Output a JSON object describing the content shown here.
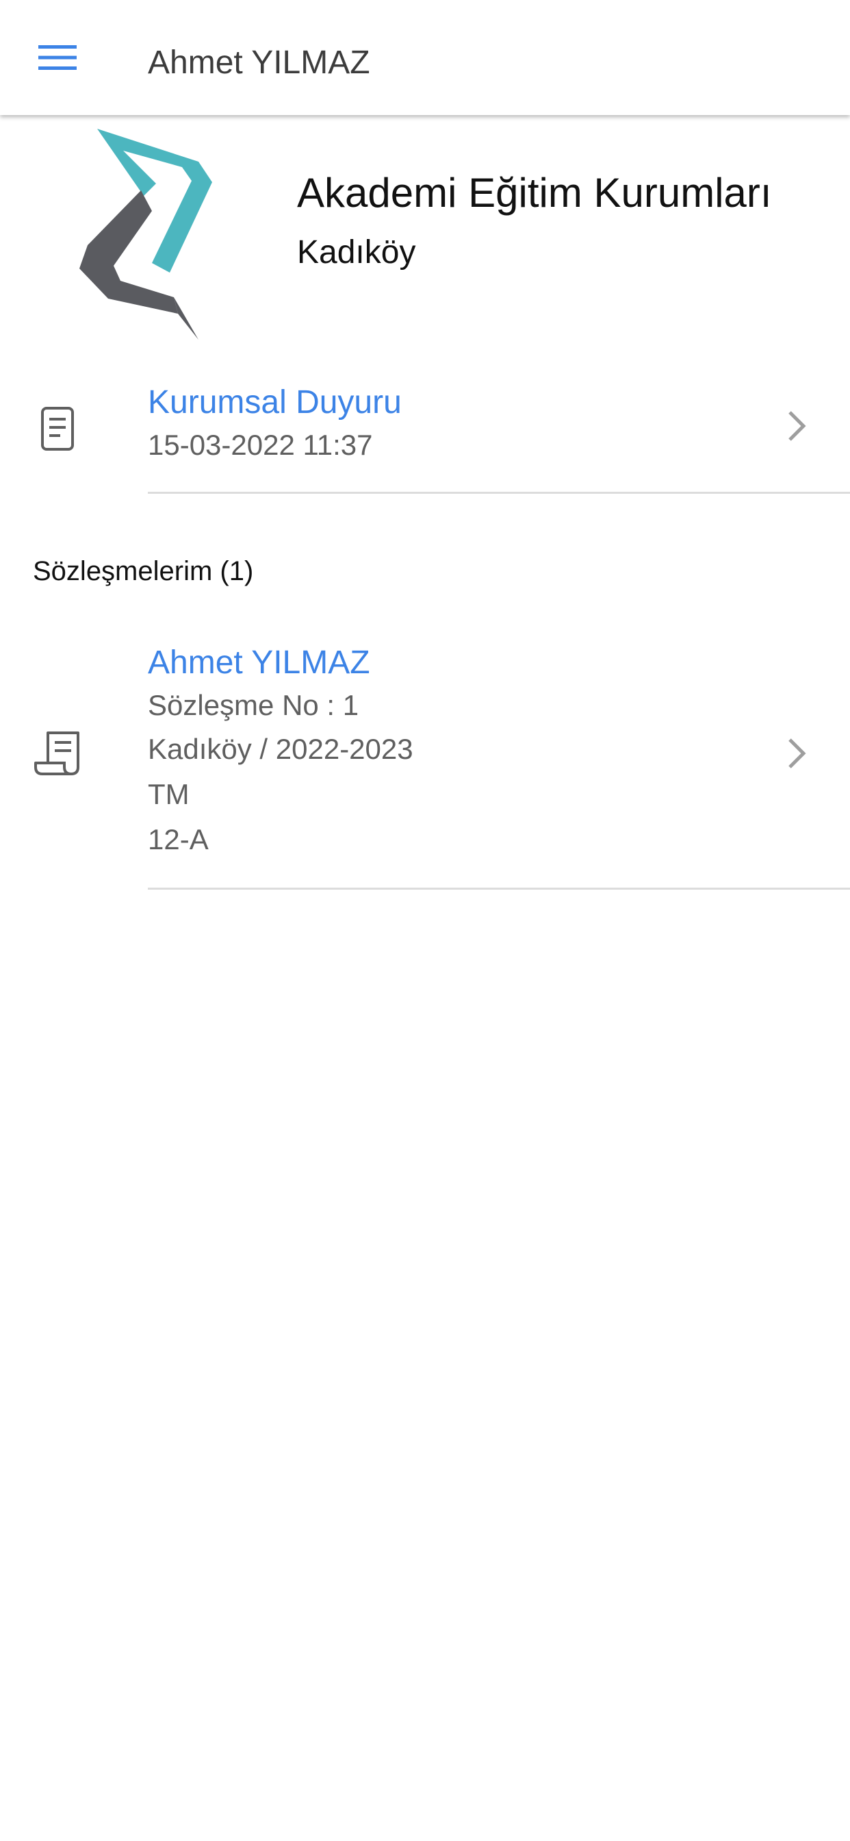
{
  "app_bar": {
    "title": "Ahmet YILMAZ",
    "menu_icon": "hamburger-menu-icon",
    "accent_color": "#3c83e6"
  },
  "school": {
    "name": "Akademi Eğitim Kurumları",
    "branch": "Kadıköy",
    "logo_colors": {
      "teal": "#4cb6bf",
      "gray": "#5a5b60"
    }
  },
  "announcement": {
    "icon": "document-icon",
    "title": "Kurumsal Duyuru",
    "date": "15-03-2022 11:37"
  },
  "contracts": {
    "section_label": "Sözleşmelerim (1)",
    "items": [
      {
        "icon": "receipt-scroll-icon",
        "title": "Ahmet YILMAZ",
        "contract_no": "Sözleşme No : 1",
        "branch_year": "Kadıköy / 2022-2023",
        "program": "TM",
        "class": "12-A"
      }
    ]
  }
}
